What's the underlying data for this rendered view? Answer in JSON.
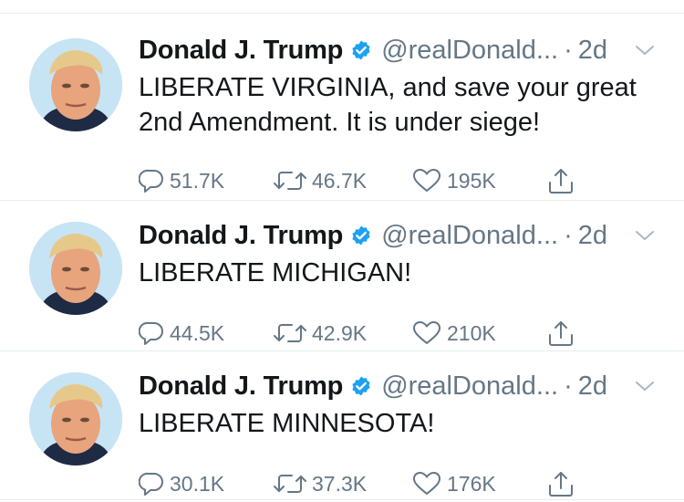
{
  "colors": {
    "text": "#14171a",
    "secondary": "#657786",
    "verified": "#1da1f2",
    "divider": "#e6ecf0"
  },
  "tweets": [
    {
      "name": "Donald J. Trump",
      "handle": "@realDonald...",
      "separator": "·",
      "time": "2d",
      "text": "LIBERATE VIRGINIA, and save your great\n2nd Amendment. It is under siege!",
      "replies": "51.7K",
      "retweets": "46.7K",
      "likes": "195K",
      "icons": [
        "verified-badge-icon",
        "chevron-down-icon",
        "reply-icon",
        "retweet-icon",
        "heart-icon",
        "share-icon"
      ]
    },
    {
      "name": "Donald J. Trump",
      "handle": "@realDonald...",
      "separator": "·",
      "time": "2d",
      "text": "LIBERATE MICHIGAN!",
      "replies": "44.5K",
      "retweets": "42.9K",
      "likes": "210K",
      "icons": [
        "verified-badge-icon",
        "chevron-down-icon",
        "reply-icon",
        "retweet-icon",
        "heart-icon",
        "share-icon"
      ]
    },
    {
      "name": "Donald J. Trump",
      "handle": "@realDonald...",
      "separator": "·",
      "time": "2d",
      "text": "LIBERATE MINNESOTA!",
      "replies": "30.1K",
      "retweets": "37.3K",
      "likes": "176K",
      "icons": [
        "verified-badge-icon",
        "chevron-down-icon",
        "reply-icon",
        "retweet-icon",
        "heart-icon",
        "share-icon"
      ]
    }
  ]
}
